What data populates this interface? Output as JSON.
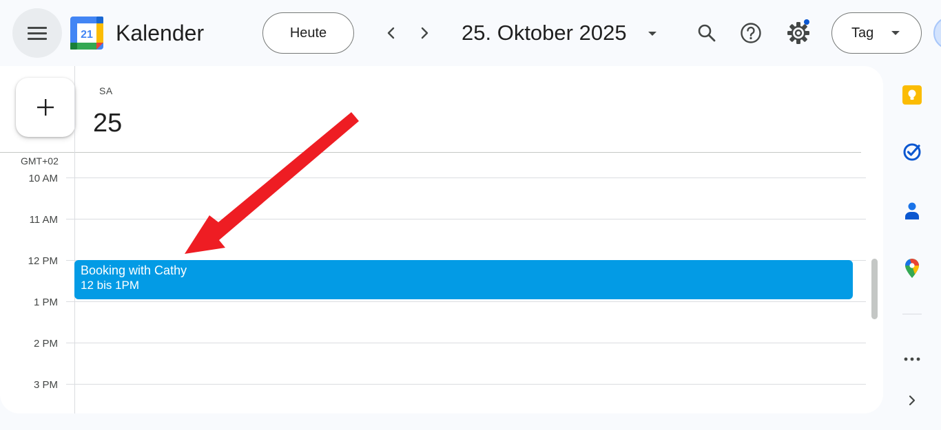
{
  "header": {
    "app_title": "Kalender",
    "logo_day": "21",
    "today_label": "Heute",
    "date_title": "25. Oktober 2025",
    "view_label": "Tag"
  },
  "day": {
    "weekday": "SA",
    "date_number": "25",
    "timezone": "GMT+02"
  },
  "hours": [
    "10 AM",
    "11 AM",
    "12 PM",
    "1 PM",
    "2 PM",
    "3 PM"
  ],
  "event": {
    "title": "Booking with Cathy",
    "time": "12 bis 1PM",
    "color": "#039be5"
  },
  "side_panel": [
    "keep-icon",
    "tasks-icon",
    "contacts-icon",
    "maps-icon"
  ],
  "colors": {
    "accent": "#0b57d0",
    "event": "#039be5",
    "annotation_arrow": "#ee1d23"
  }
}
